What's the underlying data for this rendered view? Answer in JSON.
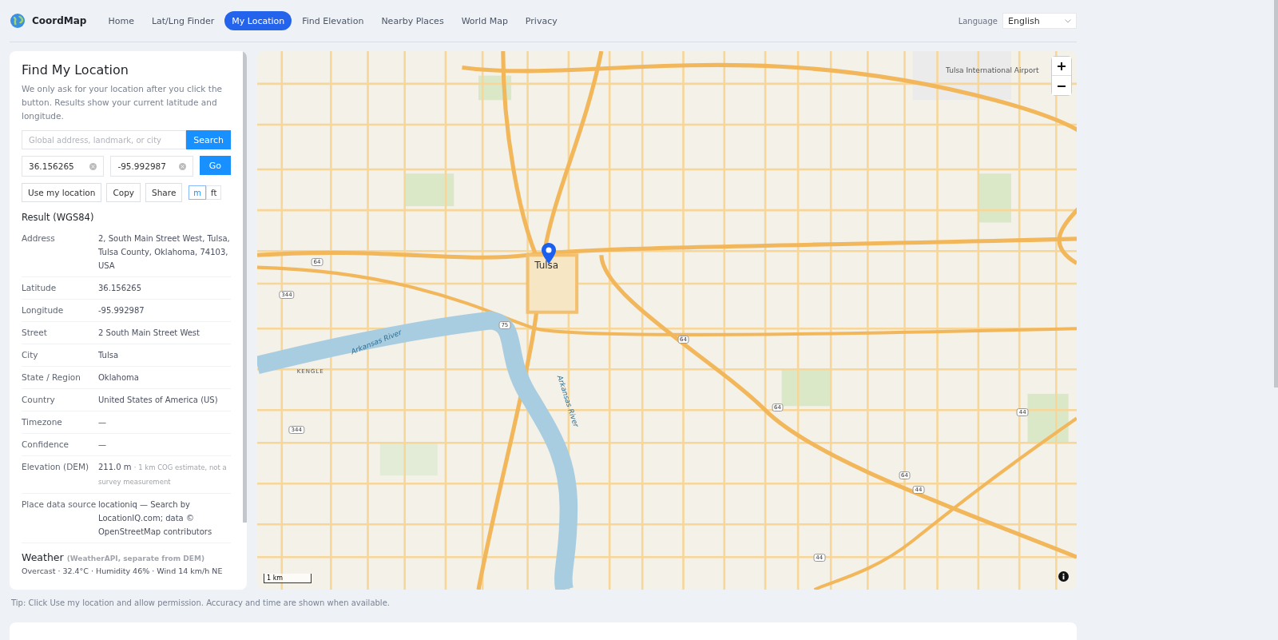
{
  "brand": {
    "name": "CoordMap"
  },
  "nav": [
    {
      "label": "Home",
      "selected": false
    },
    {
      "label": "Lat/Lng Finder",
      "selected": false
    },
    {
      "label": "My Location",
      "selected": true
    },
    {
      "label": "Find Elevation",
      "selected": false
    },
    {
      "label": "Nearby Places",
      "selected": false
    },
    {
      "label": "World Map",
      "selected": false
    },
    {
      "label": "Privacy",
      "selected": false
    }
  ],
  "language": {
    "label": "Language",
    "value": "English"
  },
  "panel": {
    "title": "Find My Location",
    "description": "We only ask for your location after you click the button. Results show your current latitude and longitude.",
    "search": {
      "placeholder": "Global address, landmark, or city",
      "button": "Search"
    },
    "coords": {
      "lat": "36.156265",
      "lng": "-95.992987",
      "button": "Go"
    },
    "actions": [
      "Use my location",
      "Copy",
      "Share"
    ],
    "units": [
      {
        "label": "m",
        "selected": true
      },
      {
        "label": "ft",
        "selected": false
      }
    ],
    "result_title": "Result (WGS84)",
    "rows": [
      {
        "label": "Address",
        "value": "2, South Main Street West, Tulsa, Tulsa County, Oklahoma, 74103, USA"
      },
      {
        "label": "Latitude",
        "value": "36.156265"
      },
      {
        "label": "Longitude",
        "value": "-95.992987"
      },
      {
        "label": "Street",
        "value": "2 South Main Street West"
      },
      {
        "label": "City",
        "value": "Tulsa"
      },
      {
        "label": "State / Region",
        "value": "Oklahoma"
      },
      {
        "label": "Country",
        "value": "United States of America (US)"
      },
      {
        "label": "Timezone",
        "value": "—"
      },
      {
        "label": "Confidence",
        "value": "—"
      },
      {
        "label": "Elevation (DEM)",
        "value": "211.0 m",
        "note": "· 1 km COG estimate, not a survey measurement"
      },
      {
        "label": "Place data source",
        "value": "locationiq — Search by LocationIQ.com; data © OpenStreetMap contributors"
      }
    ],
    "weather": {
      "title": "Weather",
      "note": "(WeatherAPI, separate from DEM)",
      "summary": "Overcast · 32.4°C · Humidity 46% · Wind 14 km/h NE"
    }
  },
  "map": {
    "labels": [
      {
        "text": "Tulsa International Airport",
        "kind": "poi"
      },
      {
        "text": "Tulsa",
        "kind": "city"
      },
      {
        "text": "Arkansas River",
        "kind": "river"
      },
      {
        "text": "Arkansas River",
        "kind": "river"
      },
      {
        "text": "KENGLE",
        "kind": "area"
      }
    ],
    "shields": [
      "64",
      "344",
      "75",
      "64",
      "64",
      "344",
      "44",
      "64",
      "44",
      "44"
    ],
    "scale": "1 km"
  },
  "tip": "Tip: Click Use my location and allow permission. Accuracy and time are shown when available."
}
